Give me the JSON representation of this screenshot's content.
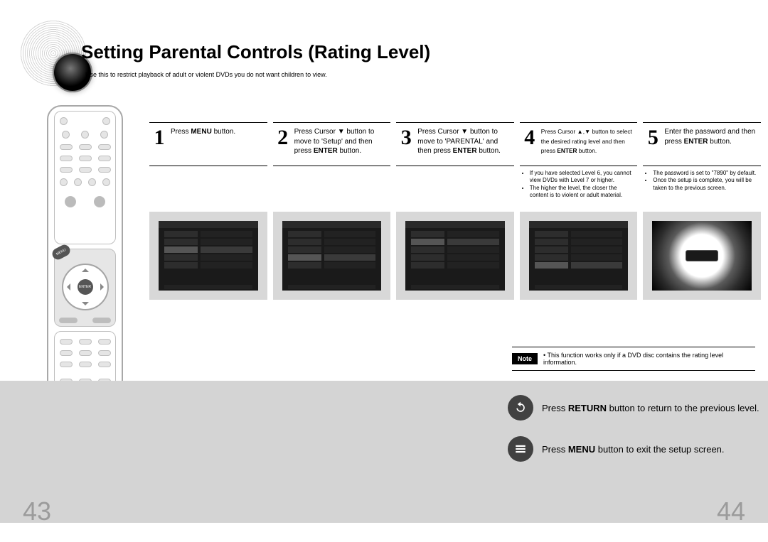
{
  "title": "Setting Parental Controls (Rating Level)",
  "subtitle": "Use this to restrict playback of adult or violent DVDs you do not want children to view.",
  "steps": [
    {
      "num": "1",
      "html": "Press <b>MENU</b> button.",
      "notes": []
    },
    {
      "num": "2",
      "html": "Press Cursor ▼ button to move to 'Setup' and then press <b>ENTER</b> button.",
      "notes": []
    },
    {
      "num": "3",
      "html": "Press Cursor ▼ button to move to 'PARENTAL' and then press <b>ENTER</b> button.",
      "notes": []
    },
    {
      "num": "4",
      "html": "<span class='d'>Press Cursor ▲,▼ button to select the desired rating level and then press <b>ENTER</b> button.</span>",
      "notes": [
        "If you have selected Level 6, you cannot view DVDs with Level 7 or higher.",
        "The higher the level, the closer the content is to violent or adult material."
      ]
    },
    {
      "num": "5",
      "html": "Enter the password and then press <b>ENTER</b> button.",
      "notes": [
        "The password is set to \"7890\" by default.",
        "Once the setup is complete, you will be taken to the previous screen."
      ]
    }
  ],
  "note": {
    "chip": "Note",
    "text": "This function works only if a DVD disc contains the rating level information."
  },
  "bottom": {
    "return": {
      "pre": "Press ",
      "b": "RETURN",
      "post": " button to return to the previous level."
    },
    "menu": {
      "pre": "Press ",
      "b": "MENU",
      "post": " button to exit the setup screen."
    }
  },
  "remote": {
    "enter": "ENTER",
    "menu": "MENU"
  },
  "pages": {
    "left": "43",
    "right": "44"
  }
}
